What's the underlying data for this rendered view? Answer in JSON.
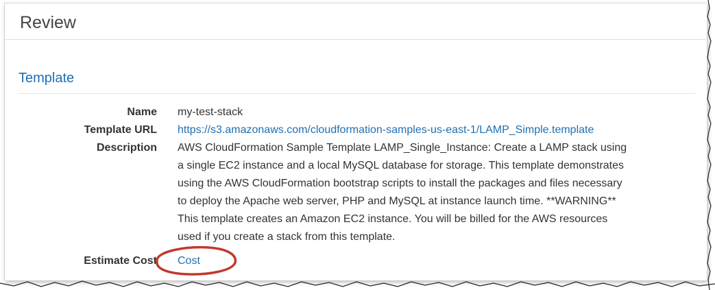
{
  "review": {
    "title": "Review"
  },
  "template": {
    "section_title": "Template",
    "name_label": "Name",
    "name_value": "my-test-stack",
    "url_label": "Template URL",
    "url_value": "https://s3.amazonaws.com/cloudformation-samples-us-east-1/LAMP_Simple.template",
    "description_label": "Description",
    "description_lines": [
      "AWS CloudFormation Sample Template LAMP_Single_Instance: Create a LAMP stack using",
      "a single EC2 instance and a local MySQL database for storage. This template demonstrates",
      "using the AWS CloudFormation bootstrap scripts to install the packages and files necessary",
      "to deploy the Apache web server, PHP and MySQL at instance launch time. **WARNING**",
      "This template creates an Amazon EC2 instance. You will be billed for the AWS resources",
      "used if you create a stack from this template."
    ],
    "estimate_label": "Estimate Cost",
    "estimate_link": "Cost"
  },
  "colors": {
    "link": "#1f6fb2",
    "callout": "#c0392b",
    "text": "#333333"
  }
}
